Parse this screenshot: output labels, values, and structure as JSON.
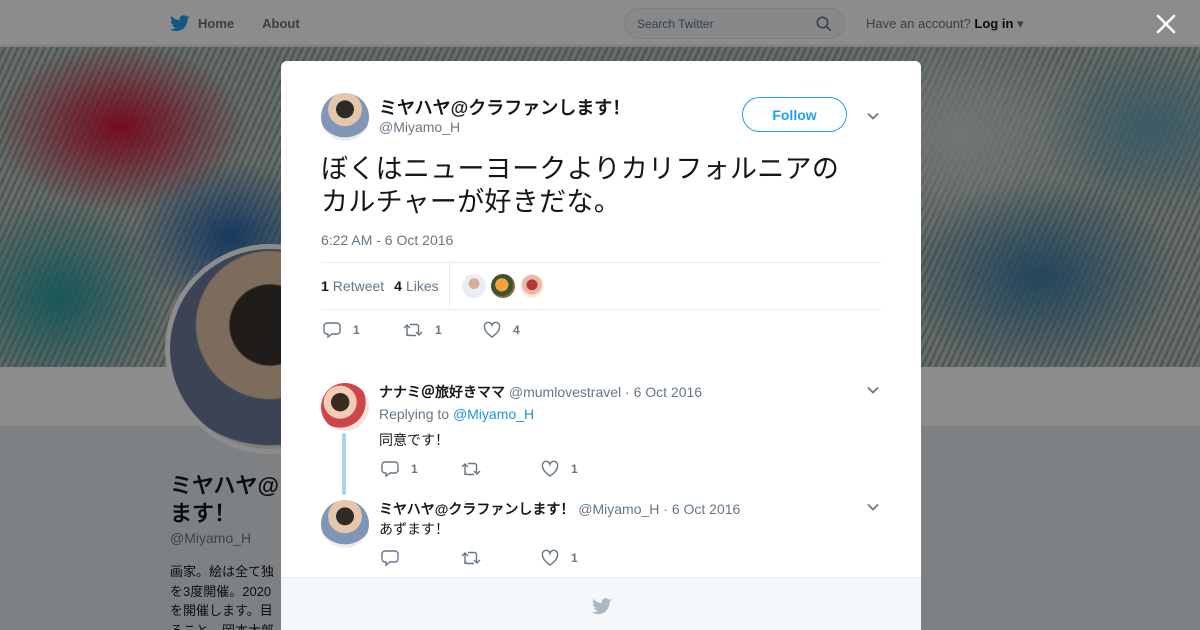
{
  "nav": {
    "home_label": "Home",
    "about_label": "About"
  },
  "search": {
    "placeholder": "Search Twitter"
  },
  "account": {
    "prompt": "Have an account?",
    "login_label": "Log in"
  },
  "background_profile": {
    "name": "ミヤハヤ@クラファンします！",
    "name_line1": "ミヤハヤ@",
    "name_line2": "ます！",
    "handle": "@Miyamo_H",
    "bio_lines": [
      "画家。絵は全て独",
      "を3度開催。2020",
      "を開催します。目",
      "ること。岡本太郎"
    ]
  },
  "tweet": {
    "author_name": "ミヤハヤ@クラファンします！",
    "author_handle": "@Miyamo_H",
    "follow_label": "Follow",
    "text_line1": "ぼくはニューヨークよりカリフォルニアの",
    "text_line2": "カルチャーが好きだな。",
    "timestamp": "6:22 AM - 6 Oct 2016",
    "retweet_count": "1",
    "retweet_label": "Retweet",
    "like_count": "4",
    "like_label": "Likes",
    "action_reply_count": "1",
    "action_retweet_count": "1",
    "action_like_count": "4"
  },
  "replies": [
    {
      "name": "ナナミ＠旅好きママ",
      "handle": "@mumlovestravel",
      "date": "· 6 Oct 2016",
      "replying_prefix": "Replying to",
      "replying_to": "@Miyamo_H",
      "text": "同意です！",
      "reply_count": "1",
      "retweet_count": "",
      "like_count": "1"
    },
    {
      "name": "ミヤハヤ@クラファンします！",
      "handle": "@Miyamo_H",
      "date": "· 6 Oct 2016",
      "text": "あずます！",
      "reply_count": "",
      "retweet_count": "",
      "like_count": "1"
    }
  ],
  "colors": {
    "accent": "#1da1f2",
    "link": "#1b95e0",
    "muted": "#657786",
    "thread_line": "#a8d4f2"
  }
}
